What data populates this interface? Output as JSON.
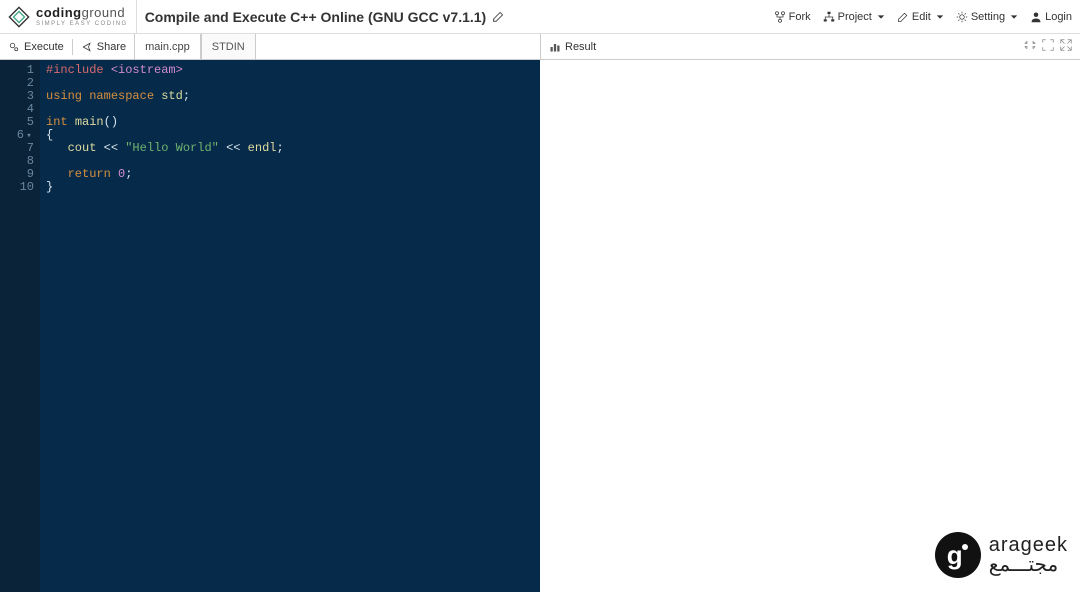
{
  "header": {
    "logo_bold": "coding",
    "logo_reg": "ground",
    "logo_sub": "SIMPLY EASY CODING",
    "title": "Compile and Execute C++ Online (GNU GCC v7.1.1)"
  },
  "top_actions": {
    "fork": "Fork",
    "project": "Project",
    "edit": "Edit",
    "setting": "Setting",
    "login": "Login"
  },
  "toolbar": {
    "execute": "Execute",
    "share": "Share",
    "tab_main": "main.cpp",
    "tab_stdin": "STDIN",
    "result": "Result"
  },
  "code": {
    "lines": [
      "1",
      "2",
      "3",
      "4",
      "5",
      "6",
      "7",
      "8",
      "9",
      "10"
    ],
    "fold_line": "6",
    "include_kw": "#include",
    "include_hdr": "<iostream>",
    "using": "using",
    "namespace": "namespace",
    "std": "std",
    "semi": ";",
    "int": "int",
    "main": "main",
    "parens": "()",
    "lbrace": "{",
    "rbrace": "}",
    "cout": "cout",
    "llt": "<<",
    "hello": "\"Hello World\"",
    "endl": "endl",
    "return": "return",
    "zero": "0"
  },
  "watermark": {
    "g": "g",
    "top": "arageek",
    "bot": "مجتـــمع"
  }
}
